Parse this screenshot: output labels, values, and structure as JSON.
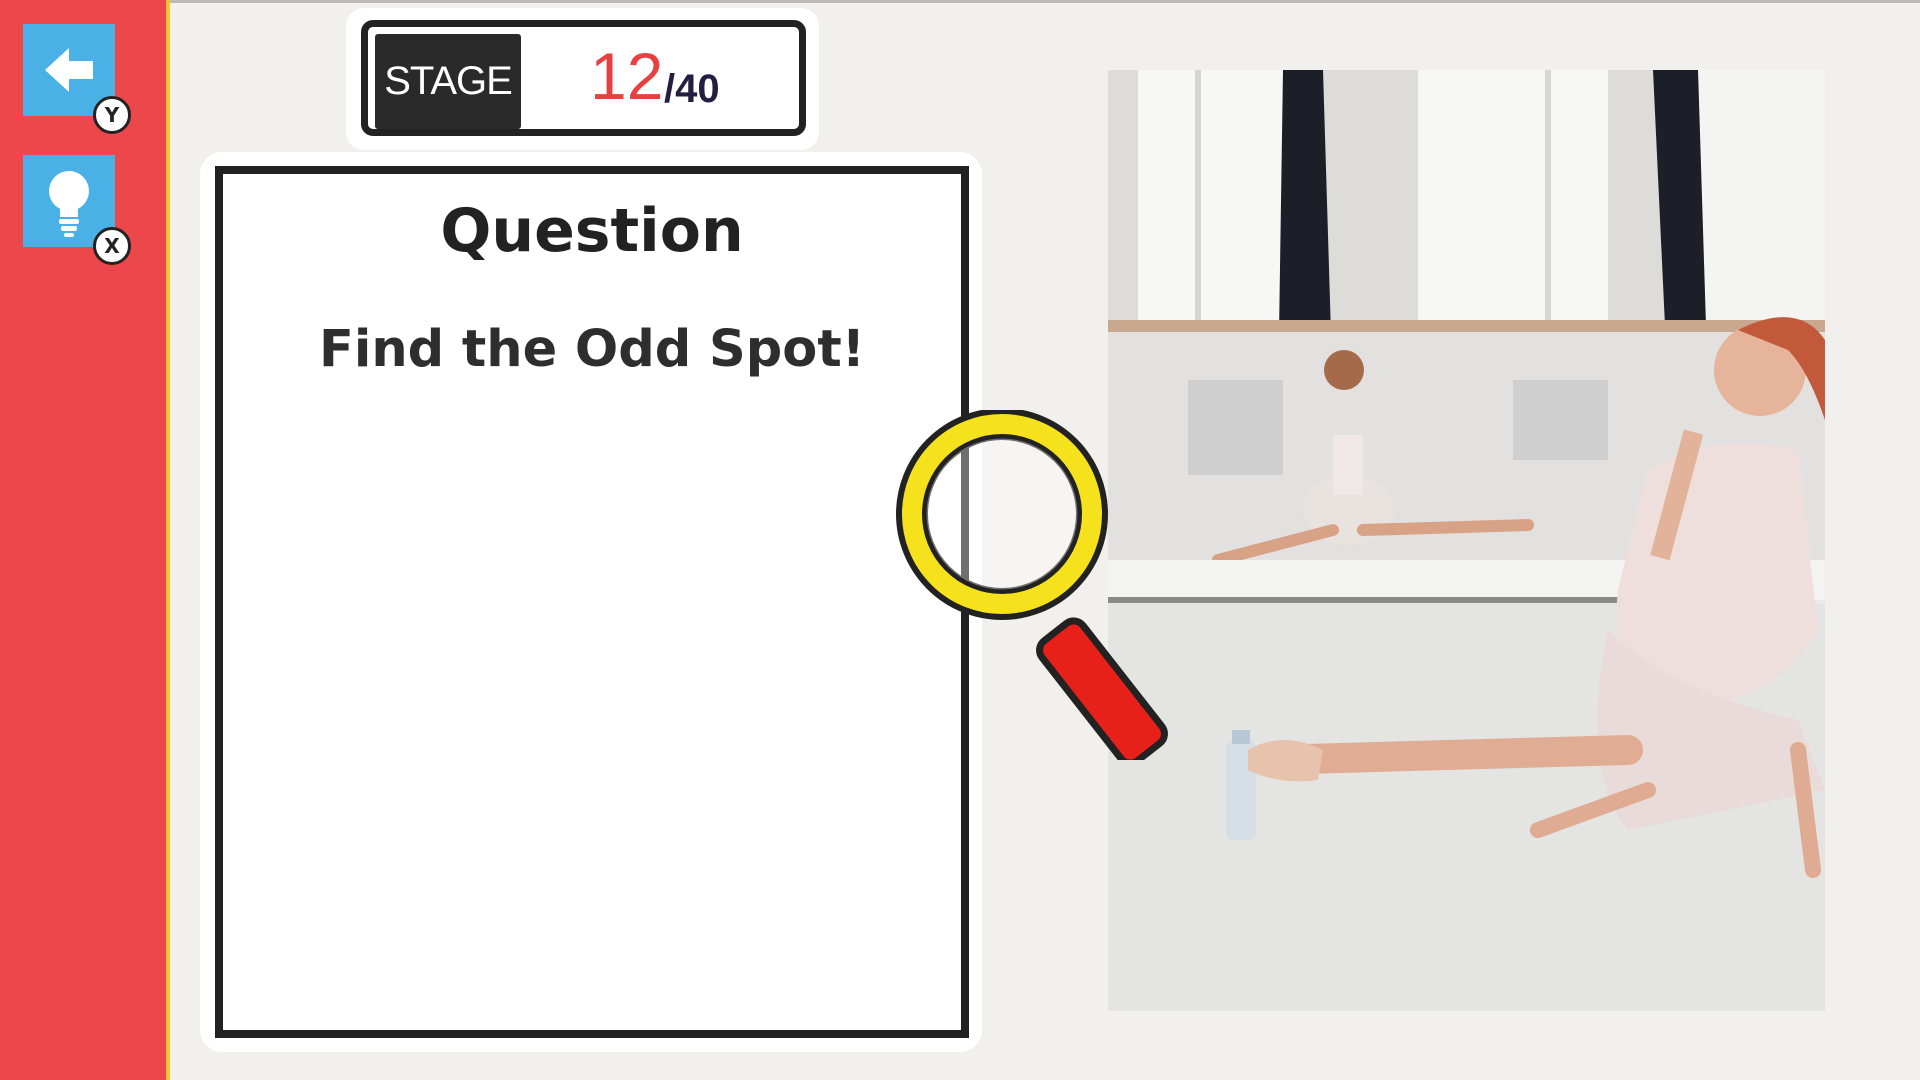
{
  "sidebar": {
    "back_button": {
      "icon": "back-arrow-icon",
      "key": "Y"
    },
    "hint_button": {
      "icon": "lightbulb-icon",
      "key": "X"
    },
    "colors": {
      "sidebar": "#ec484b",
      "border": "#f7c52b",
      "button": "#4ab1e6"
    }
  },
  "stage": {
    "label": "STAGE",
    "current": "12",
    "total": "/40",
    "current_color": "#e84040"
  },
  "question": {
    "title": "Question",
    "text": "Find the Odd Spot!"
  },
  "magnifier": {
    "icon": "magnifying-glass-icon",
    "ring_color": "#f5e21c",
    "handle_color": "#e8201a"
  },
  "puzzle_image": {
    "description_icon": "ballerina-photo"
  }
}
